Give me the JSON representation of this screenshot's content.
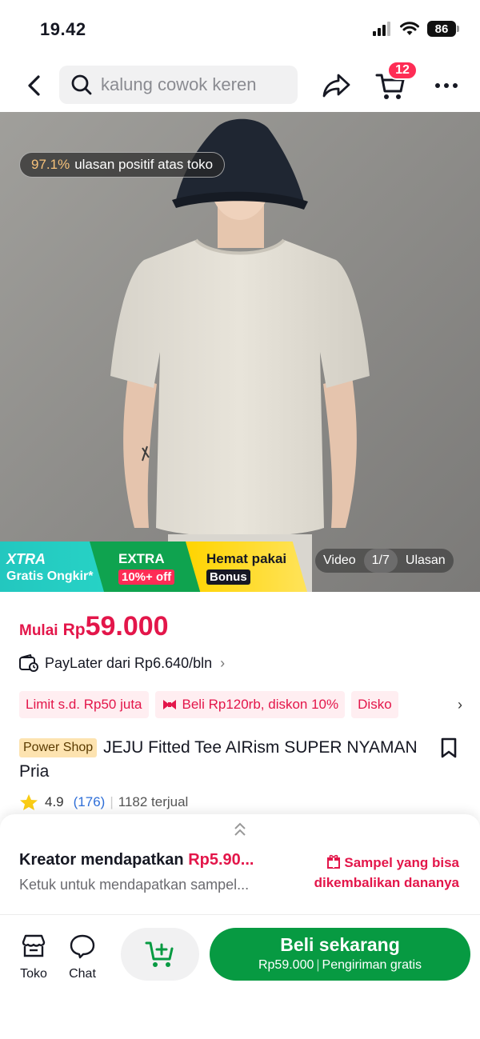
{
  "status_bar": {
    "time": "19.42",
    "battery": "86"
  },
  "search": {
    "query": "kalung cowok keren"
  },
  "cart": {
    "badge_count": "12"
  },
  "hero": {
    "review_pct": "97.1%",
    "review_text": "ulasan positif atas toko",
    "media_tabs": [
      "Video",
      "1/7",
      "Ulasan"
    ],
    "promos": {
      "xtra_title": "XTRA",
      "xtra_sub": "Gratis Ongkir*",
      "extra_title": "EXTRA",
      "extra_sub": "10%+ off",
      "hemat_title": "Hemat pakai",
      "hemat_sub": "Bonus"
    }
  },
  "price": {
    "prefix": "Mulai",
    "currency": "Rp",
    "value": "59.000",
    "color": "#e3164a"
  },
  "paylater": {
    "text": "PayLater dari Rp6.640/bln"
  },
  "chips": [
    "Limit s.d. Rp50 juta",
    "Beli Rp120rb, diskon 10%",
    "Disko"
  ],
  "product": {
    "badge": "Power Shop",
    "title": "JEJU Fitted Tee AIRism SUPER NYAMAN Pria",
    "rating": "4.9",
    "review_count": "(176)",
    "sold": "1182 terjual"
  },
  "sheet": {
    "creator_label": "Kreator mendapatkan",
    "creator_amount": "Rp5.90...",
    "creator_sub": "Ketuk untuk mendapatkan sampel...",
    "sample_text": "Sampel yang bisa dikembalikan dananya"
  },
  "action_bar": {
    "shop_label": "Toko",
    "chat_label": "Chat",
    "buy_label": "Beli sekarang",
    "buy_price": "Rp59.000",
    "buy_shipping": "Pengiriman gratis",
    "accent": "#079a42"
  }
}
